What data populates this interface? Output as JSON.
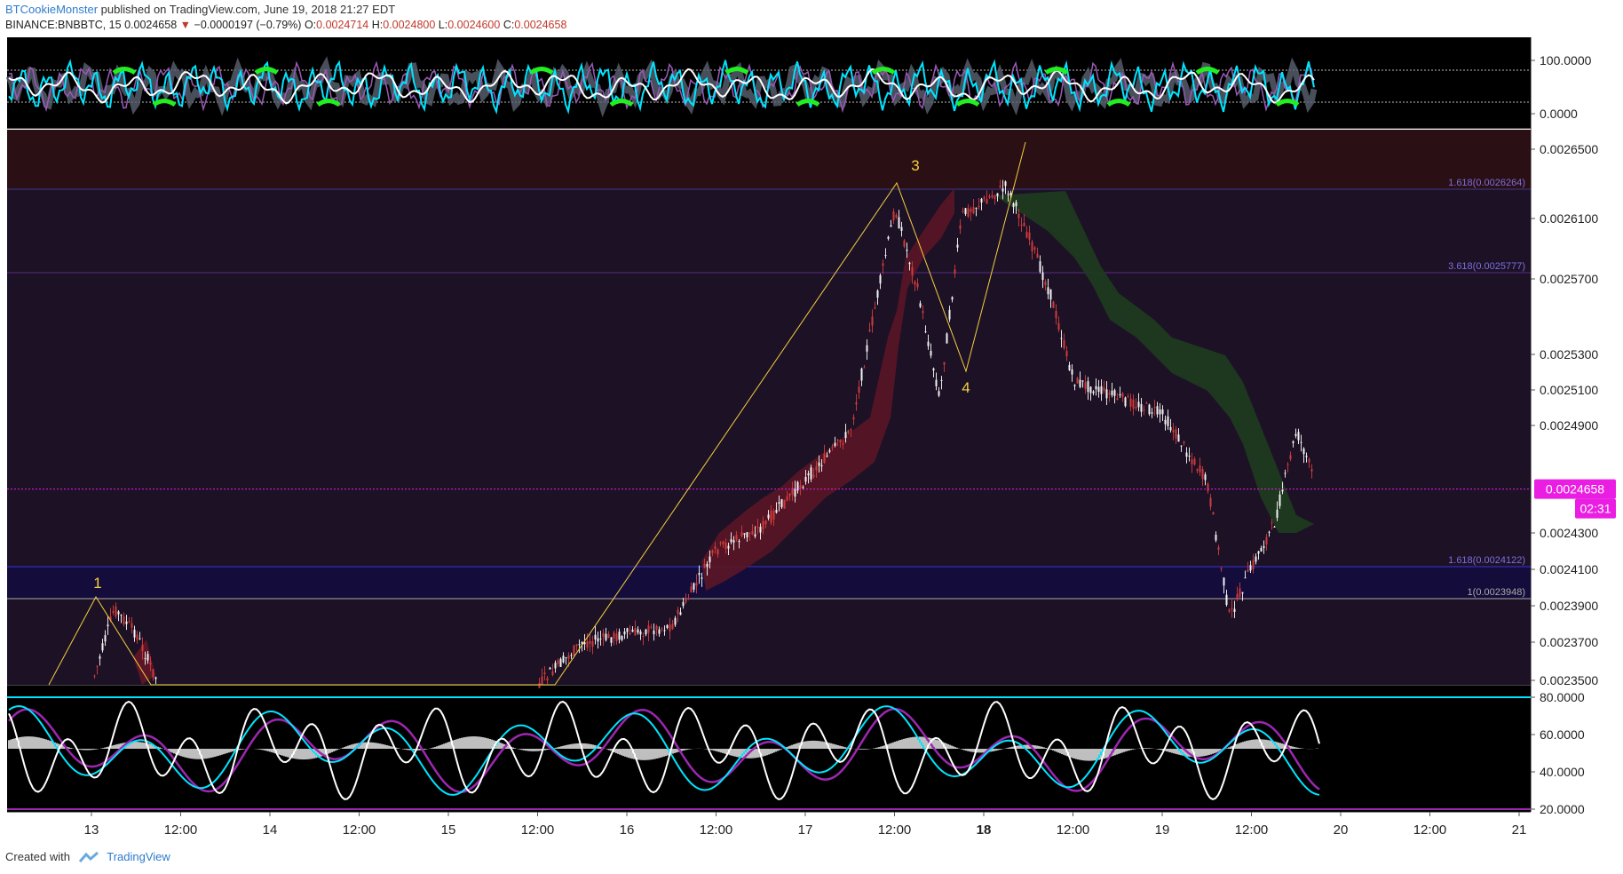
{
  "header": {
    "author": "BTCookieMonster",
    "published": "published on TradingView.com, June 19, 2018 21:27 EDT",
    "symbol": "BINANCE:BNBBTC, 15",
    "last": "0.0024658",
    "change_arrow": "▼",
    "change": "−0.0000197 (−0.79%)",
    "o_label": "O:",
    "o_value": "0.0024714",
    "h_label": "H:",
    "h_value": "0.0024800",
    "l_label": "L:",
    "l_value": "0.0024600",
    "c_label": "C:",
    "c_value": "0.0024658"
  },
  "footer": {
    "created_with": "Created with",
    "brand": "TradingView"
  },
  "colors": {
    "pane_bg": "#000000",
    "main_bg": "#1a0f21",
    "accent_magenta": "#e91ee2",
    "cyan": "#00e5ff",
    "purple": "#9c27b0",
    "wave_yellow": "#f4d03f",
    "fib_line": "#5b4bd6"
  },
  "top_pane": {
    "ticks": [
      "100.0000",
      "0.0000"
    ]
  },
  "main_pane": {
    "price_ticks": [
      "0.0026500",
      "0.0026100",
      "0.0025700",
      "0.0025300",
      "0.0025100",
      "0.0024900",
      "0.0024300",
      "0.0024100",
      "0.0023900",
      "0.0023700",
      "0.0023500"
    ],
    "fib_levels": [
      {
        "label": "1.618(0.0026264)"
      },
      {
        "label": "3.618(0.0025777)"
      },
      {
        "label": "1.618(0.0024122)"
      },
      {
        "label": "1(0.0023948)"
      }
    ],
    "current_price": "0.0024658",
    "countdown": "02:31",
    "wave_labels": [
      "1",
      "3",
      "4"
    ]
  },
  "bottom_pane": {
    "ticks": [
      "80.0000",
      "60.0000",
      "40.0000",
      "20.0000"
    ]
  },
  "time_axis": [
    "13",
    "12:00",
    "14",
    "12:00",
    "15",
    "12:00",
    "16",
    "12:00",
    "17",
    "12:00",
    "18",
    "12:00",
    "19",
    "12:00",
    "20",
    "12:00",
    "21"
  ],
  "chart_data": {
    "type": "line",
    "title": "BINANCE:BNBBTC, 15",
    "series": [
      {
        "name": "BNBBTC",
        "x": [
          "13 00:00",
          "13 03:00",
          "13 06:00",
          "13 09:00",
          "15 12:00",
          "15 18:00",
          "16 06:00",
          "16 12:00",
          "16 18:00",
          "17 06:00",
          "17 12:00",
          "17 15:00",
          "17 18:00",
          "17 21:00",
          "18 03:00",
          "18 06:00",
          "18 09:00",
          "18 12:00",
          "18 18:00",
          "19 00:00",
          "19 06:00",
          "19 09:00",
          "19 12:00",
          "19 15:00",
          "19 18:00",
          "19 21:00"
        ],
        "y": [
          0.00235,
          0.002395,
          0.00238,
          0.00235,
          0.00235,
          0.002375,
          0.002385,
          0.00243,
          0.002443,
          0.0025,
          0.002632,
          0.002585,
          0.00252,
          0.002628,
          0.002645,
          0.002615,
          0.00258,
          0.00253,
          0.00252,
          0.00251,
          0.00247,
          0.00239,
          0.00242,
          0.002445,
          0.0025,
          0.0024658
        ]
      }
    ],
    "ylim": [
      0.00235,
      0.00268
    ]
  }
}
